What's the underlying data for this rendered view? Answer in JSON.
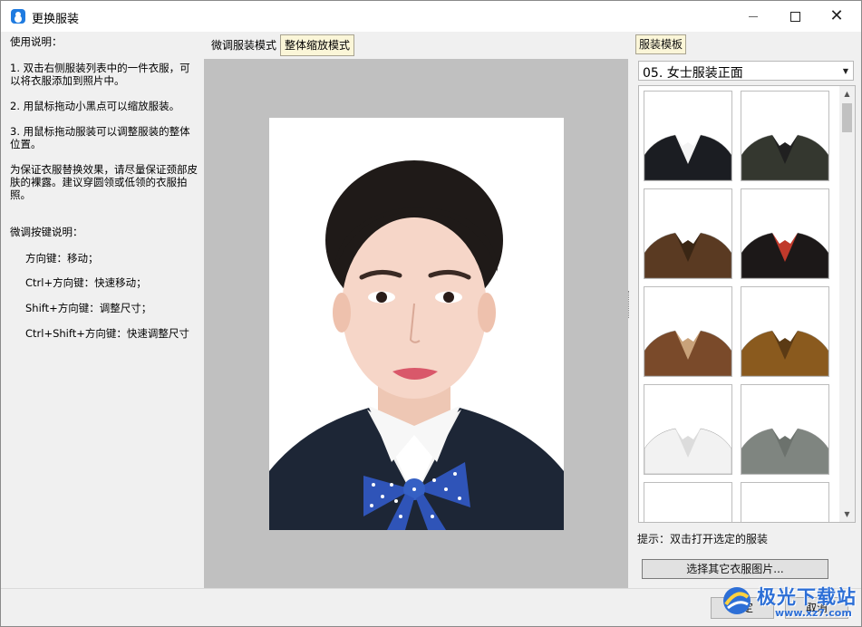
{
  "window": {
    "title": "更换服装"
  },
  "left_panel": {
    "usage_title": "使用说明：",
    "steps": [
      "1. 双击右侧服装列表中的一件衣服，可以将衣服添加到照片中。",
      "2. 用鼠标拖动小黑点可以缩放服装。",
      "3. 用鼠标拖动服装可以调整服装的整体位置。"
    ],
    "note": "为保证衣服替换效果，请尽量保证颈部皮肤的裸露。建议穿圆领或低领的衣服拍照。",
    "keys_title": "微调按键说明：",
    "keys": [
      "方向键：移动；",
      "Ctrl+方向键：快速移动；",
      "Shift+方向键：调整尺寸；",
      "Ctrl+Shift+方向键：快速调整尺寸"
    ]
  },
  "center": {
    "tabs": [
      "微调服装模式",
      "整体缩放模式"
    ],
    "active_tab": "整体缩放模式"
  },
  "right_panel": {
    "tab_label": "服装模板",
    "category_selected": "05. 女士服装正面",
    "clothing_items": [
      {
        "name": "black-suit-white-collar",
        "color": "#1b1d22",
        "inner": "#f4f4f4"
      },
      {
        "name": "dark-floral-jacket",
        "color": "#34372f",
        "inner": "#202020"
      },
      {
        "name": "brown-pattern-top",
        "color": "#5a3a22",
        "inner": "#3a2614"
      },
      {
        "name": "black-top-red-scarf",
        "color": "#1c1818",
        "inner": "#c0392b"
      },
      {
        "name": "brown-scarf-blouse",
        "color": "#7a4a2a",
        "inner": "#c9a27a"
      },
      {
        "name": "leopard-blouse",
        "color": "#8a5a1e",
        "inner": "#5b3a14"
      },
      {
        "name": "white-blazer",
        "color": "#f2f2f2",
        "inner": "#dcdcdc"
      },
      {
        "name": "grey-shirt",
        "color": "#7f8580",
        "inner": "#6c726d"
      },
      {
        "name": "white-top-a",
        "color": "#fafafa",
        "inner": "#eeeeee"
      },
      {
        "name": "white-top-b",
        "color": "#fafafa",
        "inner": "#eeeeee"
      }
    ],
    "hint": "提示：双击打开选定的服装",
    "choose_button": "选择其它衣服图片..."
  },
  "bottom": {
    "ok": "确定",
    "cancel": "取消"
  },
  "watermark": {
    "text": "极光下载站",
    "url": "www.xz7.com"
  },
  "colors": {
    "accent": "#1f7be0",
    "active_tab": "#fbf6d8",
    "photo_bg": "#c0c0c0"
  }
}
